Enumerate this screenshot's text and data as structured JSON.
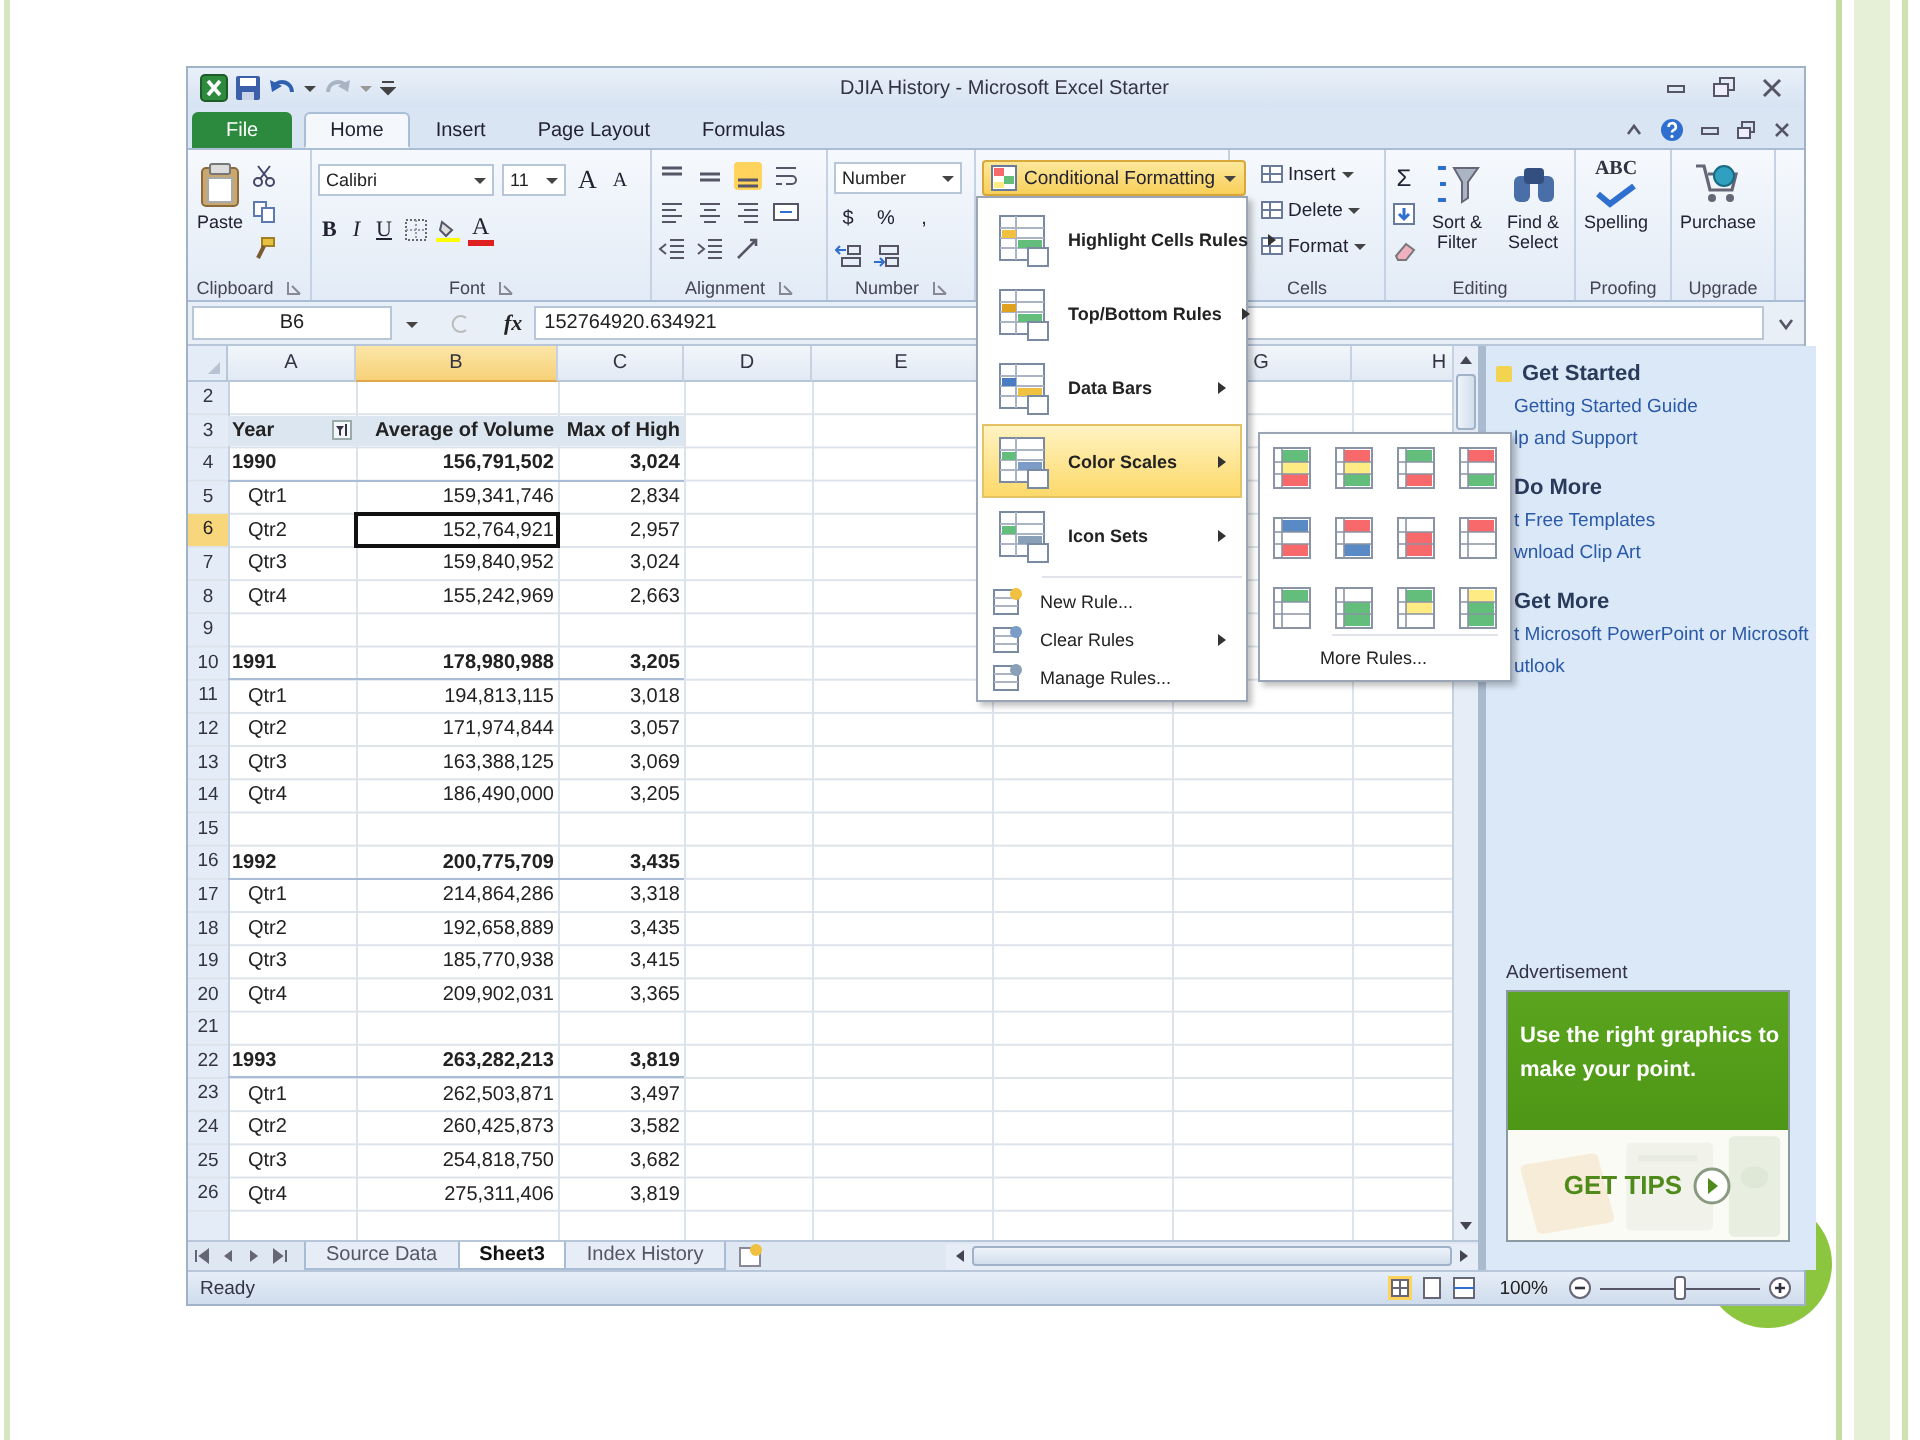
{
  "window": {
    "title": "DJIA History - Microsoft Excel Starter"
  },
  "tabs": [
    {
      "label": "File",
      "kind": "file",
      "selected": false
    },
    {
      "label": "Home",
      "kind": "tab",
      "selected": true
    },
    {
      "label": "Insert",
      "kind": "tab",
      "selected": false
    },
    {
      "label": "Page Layout",
      "kind": "tab",
      "selected": false
    },
    {
      "label": "Formulas",
      "kind": "tab",
      "selected": false
    }
  ],
  "ribbon": {
    "clipboard": {
      "paste": "Paste",
      "label": "Clipboard"
    },
    "font": {
      "name": "Calibri",
      "size": "11",
      "grow": "A",
      "shrink": "A",
      "bold": "B",
      "italic": "I",
      "underline": "U",
      "font_color": "A",
      "label": "Font"
    },
    "alignment": {
      "label": "Alignment"
    },
    "number": {
      "format": "Number",
      "currency": "$",
      "percent": "%",
      "comma": ",",
      "label": "Number"
    },
    "styles": {
      "conditional_formatting": "Conditional Formatting"
    },
    "cells": {
      "buttons": [
        "Insert",
        "Delete",
        "Format"
      ],
      "label": "Cells"
    },
    "editing": {
      "sum": "Σ",
      "sort": "Sort & Filter",
      "find": "Find & Select",
      "label": "Editing"
    },
    "proofing": {
      "spelling_icon": "ABC",
      "spelling": "Spelling",
      "label": "Proofing"
    },
    "upgrade": {
      "purchase": "Purchase",
      "label": "Upgrade"
    }
  },
  "formula_bar": {
    "name_box": "B6",
    "fx": "fx",
    "value": "152764920.634921"
  },
  "sheet": {
    "columns": [
      {
        "label": "A",
        "selected": false
      },
      {
        "label": "B",
        "selected": true
      },
      {
        "label": "C",
        "selected": false
      },
      {
        "label": "D",
        "selected": false
      },
      {
        "label": "E",
        "selected": false
      },
      {
        "label": "G",
        "selected": false
      },
      {
        "label": "H",
        "selected": false
      }
    ],
    "rows": [
      {
        "number": "2",
        "kind": "blank",
        "selected": false
      },
      {
        "number": "3",
        "kind": "header",
        "selected": false,
        "cells": [
          "Year",
          "Average of Volume",
          "Max of High"
        ]
      },
      {
        "number": "4",
        "kind": "year",
        "selected": false,
        "cells": [
          "1990",
          "156,791,502",
          "3,024"
        ]
      },
      {
        "number": "5",
        "kind": "quarter",
        "selected": false,
        "cells": [
          "Qtr1",
          "159,341,746",
          "2,834"
        ]
      },
      {
        "number": "6",
        "kind": "quarter",
        "selected": true,
        "cells": [
          "Qtr2",
          "152,764,921",
          "2,957"
        ]
      },
      {
        "number": "7",
        "kind": "quarter",
        "selected": false,
        "cells": [
          "Qtr3",
          "159,840,952",
          "3,024"
        ]
      },
      {
        "number": "8",
        "kind": "quarter",
        "selected": false,
        "cells": [
          "Qtr4",
          "155,242,969",
          "2,663"
        ]
      },
      {
        "number": "9",
        "kind": "blank",
        "selected": false
      },
      {
        "number": "10",
        "kind": "year",
        "selected": false,
        "cells": [
          "1991",
          "178,980,988",
          "3,205"
        ]
      },
      {
        "number": "11",
        "kind": "quarter",
        "selected": false,
        "cells": [
          "Qtr1",
          "194,813,115",
          "3,018"
        ]
      },
      {
        "number": "12",
        "kind": "quarter",
        "selected": false,
        "cells": [
          "Qtr2",
          "171,974,844",
          "3,057"
        ]
      },
      {
        "number": "13",
        "kind": "quarter",
        "selected": false,
        "cells": [
          "Qtr3",
          "163,388,125",
          "3,069"
        ]
      },
      {
        "number": "14",
        "kind": "quarter",
        "selected": false,
        "cells": [
          "Qtr4",
          "186,490,000",
          "3,205"
        ]
      },
      {
        "number": "15",
        "kind": "blank",
        "selected": false
      },
      {
        "number": "16",
        "kind": "year",
        "selected": false,
        "cells": [
          "1992",
          "200,775,709",
          "3,435"
        ]
      },
      {
        "number": "17",
        "kind": "quarter",
        "selected": false,
        "cells": [
          "Qtr1",
          "214,864,286",
          "3,318"
        ]
      },
      {
        "number": "18",
        "kind": "quarter",
        "selected": false,
        "cells": [
          "Qtr2",
          "192,658,889",
          "3,435"
        ]
      },
      {
        "number": "19",
        "kind": "quarter",
        "selected": false,
        "cells": [
          "Qtr3",
          "185,770,938",
          "3,415"
        ]
      },
      {
        "number": "20",
        "kind": "quarter",
        "selected": false,
        "cells": [
          "Qtr4",
          "209,902,031",
          "3,365"
        ]
      },
      {
        "number": "21",
        "kind": "blank",
        "selected": false
      },
      {
        "number": "22",
        "kind": "year",
        "selected": false,
        "cells": [
          "1993",
          "263,282,213",
          "3,819"
        ]
      },
      {
        "number": "23",
        "kind": "quarter",
        "selected": false,
        "cells": [
          "Qtr1",
          "262,503,871",
          "3,497"
        ]
      },
      {
        "number": "24",
        "kind": "quarter",
        "selected": false,
        "cells": [
          "Qtr2",
          "260,425,873",
          "3,582"
        ]
      },
      {
        "number": "25",
        "kind": "quarter",
        "selected": false,
        "cells": [
          "Qtr3",
          "254,818,750",
          "3,682"
        ]
      },
      {
        "number": "26",
        "kind": "quarter",
        "selected": false,
        "cells": [
          "Qtr4",
          "275,311,406",
          "3,819"
        ]
      }
    ]
  },
  "conditional_menu": {
    "items": [
      {
        "label": "Highlight Cells Rules",
        "kind": "large",
        "submenu": true,
        "selected": false
      },
      {
        "label": "Top/Bottom Rules",
        "kind": "large",
        "submenu": true,
        "selected": false
      },
      {
        "label": "Data Bars",
        "kind": "large",
        "submenu": true,
        "selected": false
      },
      {
        "label": "Color Scales",
        "kind": "large",
        "submenu": true,
        "selected": true
      },
      {
        "label": "Icon Sets",
        "kind": "large",
        "submenu": true,
        "selected": false
      },
      {
        "label": "New Rule...",
        "kind": "small",
        "submenu": false,
        "selected": false
      },
      {
        "label": "Clear Rules",
        "kind": "small",
        "submenu": true,
        "selected": false
      },
      {
        "label": "Manage Rules...",
        "kind": "small",
        "submenu": false,
        "selected": false
      }
    ],
    "more_rules": "More Rules..."
  },
  "task_pane": {
    "sections": [
      {
        "heading": "Get Started",
        "icon": true,
        "links": [
          "Getting Started Guide",
          "lp and Support"
        ]
      },
      {
        "heading": "Do More",
        "icon": false,
        "links": [
          "t Free Templates",
          "wnload Clip Art"
        ]
      },
      {
        "heading": "Get More",
        "icon": false,
        "links": [
          "t Microsoft PowerPoint or Microsoft",
          "utlook"
        ]
      }
    ],
    "ad_label": "Advertisement",
    "ad_headline": "Use the right graphics to make your point.",
    "ad_button": "GET TIPS"
  },
  "sheet_tabs": [
    {
      "label": "Source Data",
      "selected": false
    },
    {
      "label": "Sheet3",
      "selected": true
    },
    {
      "label": "Index History",
      "selected": false
    }
  ],
  "status_bar": {
    "status": "Ready",
    "zoom": "100%",
    "zoom_slider": {
      "level": 0.5
    }
  }
}
